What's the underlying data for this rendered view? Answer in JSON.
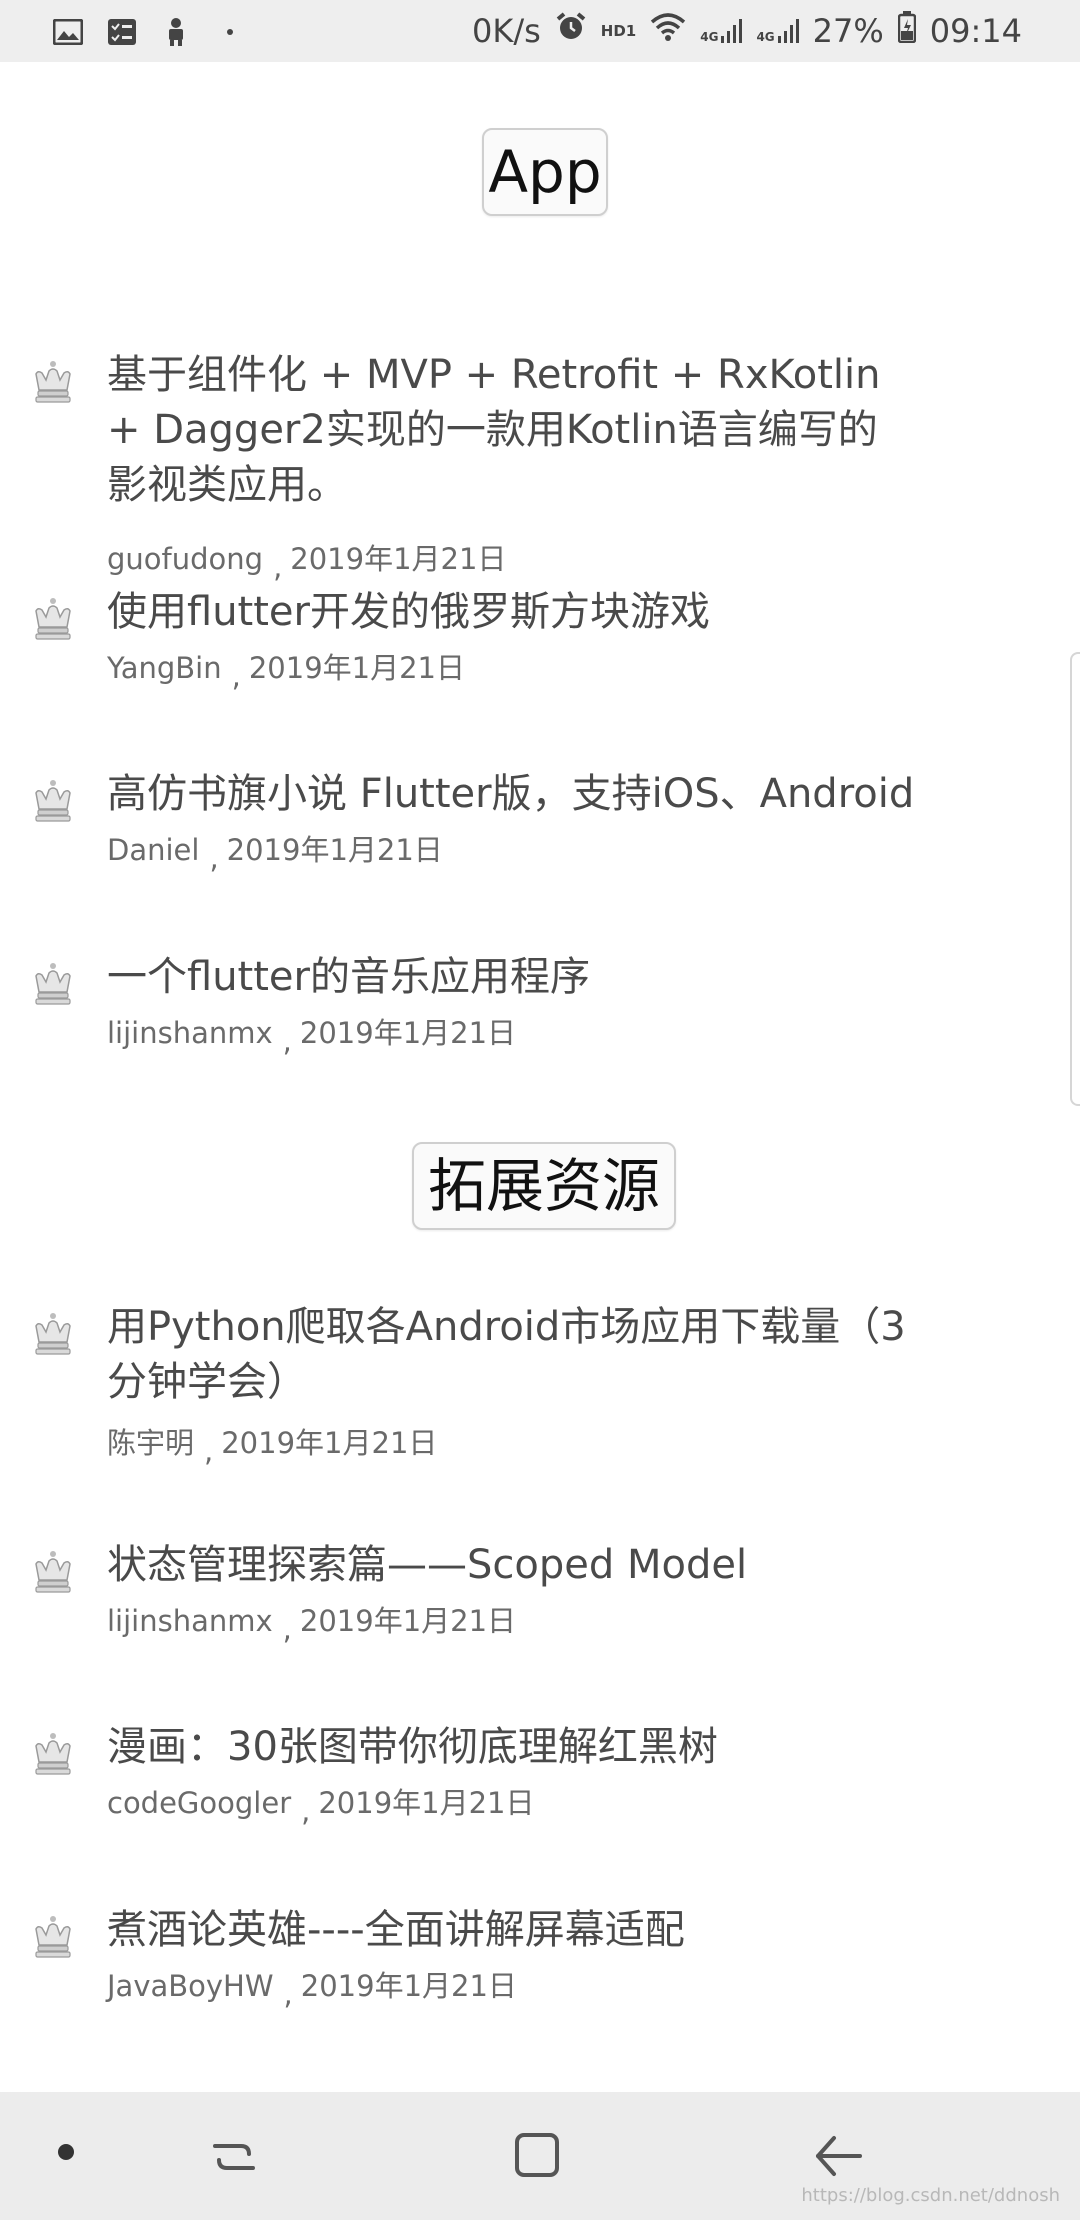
{
  "status_bar": {
    "net_speed": "0K/s",
    "hd_label": "HD1",
    "signal1_label": "4G",
    "signal2_label": "4G",
    "battery_percent": "27%",
    "time": "09:14"
  },
  "sections": [
    {
      "header": "App",
      "items": [
        {
          "title": "基于组件化 + MVP + Retrofit + RxKotlin + Dagger2实现的一款用Kotlin语言编写的影视类应用。",
          "author": "guofudong",
          "date": "2019年1月21日"
        },
        {
          "title": "使用flutter开发的俄罗斯方块游戏",
          "author": "YangBin",
          "date": "2019年1月21日"
        },
        {
          "title": "高仿书旗小说 Flutter版，支持iOS、Android",
          "author": "Daniel",
          "date": "2019年1月21日"
        },
        {
          "title": "一个flutter的音乐应用程序",
          "author": "lijinshanmx",
          "date": "2019年1月21日"
        }
      ]
    },
    {
      "header": "拓展资源",
      "items": [
        {
          "title": "用Python爬取各Android市场应用下载量（3分钟学会）",
          "author": "陈宇明",
          "date": "2019年1月21日"
        },
        {
          "title": "状态管理探索篇——Scoped Model",
          "author": "lijinshanmx",
          "date": "2019年1月21日"
        },
        {
          "title": "漫画：30张图带你彻底理解红黑树",
          "author": "codeGoogler",
          "date": "2019年1月21日"
        },
        {
          "title": "煮酒论英雄----全面讲解屏幕适配",
          "author": "JavaBoyHW",
          "date": "2019年1月21日"
        }
      ]
    }
  ],
  "meta_separator": ",",
  "icons": {
    "item": "crown-icon",
    "nav": [
      "nav-dot-icon",
      "recents-icon",
      "home-icon",
      "back-icon"
    ]
  },
  "watermark": "https://blog.csdn.net/ddnosh"
}
